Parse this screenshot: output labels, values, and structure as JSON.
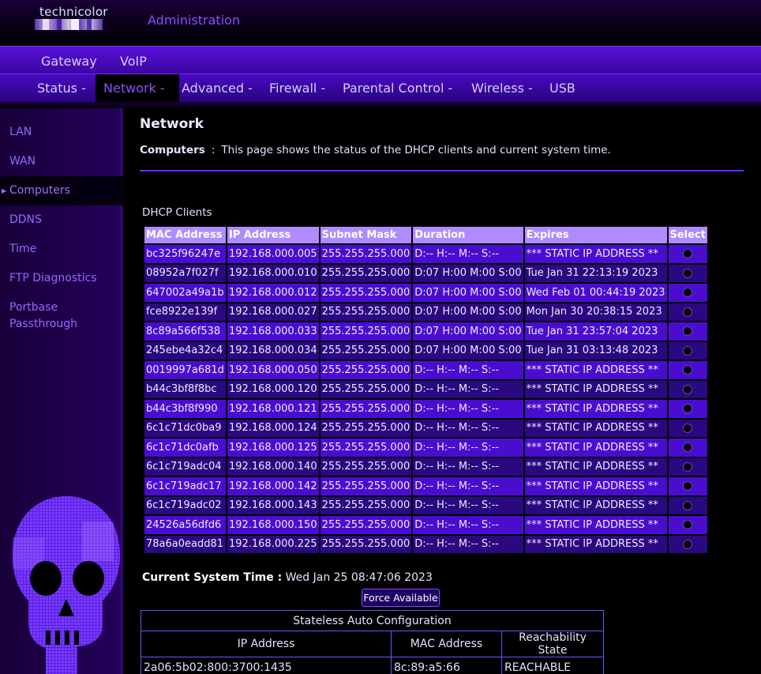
{
  "header": {
    "brand": "technicolor",
    "title": "Administration"
  },
  "nav_primary": [
    "Gateway",
    "VoIP"
  ],
  "nav_secondary": [
    {
      "label": "Status -",
      "active": false
    },
    {
      "label": "Network -",
      "active": true
    },
    {
      "label": "Advanced -",
      "active": false
    },
    {
      "label": "Firewall -",
      "active": false
    },
    {
      "label": "Parental Control -",
      "active": false
    },
    {
      "label": "Wireless -",
      "active": false
    },
    {
      "label": "USB",
      "active": false
    }
  ],
  "sidebar": {
    "items": [
      {
        "label": "LAN"
      },
      {
        "label": "WAN"
      },
      {
        "label": "Computers",
        "active": true
      },
      {
        "label": "DDNS"
      },
      {
        "label": "Time"
      },
      {
        "label": "FTP Diagnostics"
      },
      {
        "label": "Portbase Passthrough"
      }
    ]
  },
  "page": {
    "title": "Network",
    "section": "Computers",
    "separator": ":",
    "description": "This page shows the status of the DHCP clients and current system time."
  },
  "dhcp": {
    "caption": "DHCP Clients",
    "columns": [
      "MAC Address",
      "IP Address",
      "Subnet Mask",
      "Duration",
      "Expires",
      "Select"
    ],
    "rows": [
      [
        "bc325f96247e",
        "192.168.000.005",
        "255.255.255.000",
        "D:-- H:-- M:-- S:--",
        "*** STATIC IP ADDRESS **"
      ],
      [
        "08952a7f027f",
        "192.168.000.010",
        "255.255.255.000",
        "D:07 H:00 M:00 S:00",
        "Tue Jan 31 22:13:19 2023"
      ],
      [
        "647002a49a1b",
        "192.168.000.012",
        "255.255.255.000",
        "D:07 H:00 M:00 S:00",
        "Wed Feb 01 00:44:19 2023"
      ],
      [
        "fce8922e139f",
        "192.168.000.027",
        "255.255.255.000",
        "D:07 H:00 M:00 S:00",
        "Mon Jan 30 20:38:15 2023"
      ],
      [
        "8c89a566f538",
        "192.168.000.033",
        "255.255.255.000",
        "D:07 H:00 M:00 S:00",
        "Tue Jan 31 23:57:04 2023"
      ],
      [
        "245ebe4a32c4",
        "192.168.000.034",
        "255.255.255.000",
        "D:07 H:00 M:00 S:00",
        "Tue Jan 31 03:13:48 2023"
      ],
      [
        "0019997a681d",
        "192.168.000.050",
        "255.255.255.000",
        "D:-- H:-- M:-- S:--",
        "*** STATIC IP ADDRESS **"
      ],
      [
        "b44c3bf8f8bc",
        "192.168.000.120",
        "255.255.255.000",
        "D:-- H:-- M:-- S:--",
        "*** STATIC IP ADDRESS **"
      ],
      [
        "b44c3bf8f990",
        "192.168.000.121",
        "255.255.255.000",
        "D:-- H:-- M:-- S:--",
        "*** STATIC IP ADDRESS **"
      ],
      [
        "6c1c71dc0ba9",
        "192.168.000.124",
        "255.255.255.000",
        "D:-- H:-- M:-- S:--",
        "*** STATIC IP ADDRESS **"
      ],
      [
        "6c1c71dc0afb",
        "192.168.000.125",
        "255.255.255.000",
        "D:-- H:-- M:-- S:--",
        "*** STATIC IP ADDRESS **"
      ],
      [
        "6c1c719adc04",
        "192.168.000.140",
        "255.255.255.000",
        "D:-- H:-- M:-- S:--",
        "*** STATIC IP ADDRESS **"
      ],
      [
        "6c1c719adc17",
        "192.168.000.142",
        "255.255.255.000",
        "D:-- H:-- M:-- S:--",
        "*** STATIC IP ADDRESS **"
      ],
      [
        "6c1c719adc02",
        "192.168.000.143",
        "255.255.255.000",
        "D:-- H:-- M:-- S:--",
        "*** STATIC IP ADDRESS **"
      ],
      [
        "24526a56dfd6",
        "192.168.000.150",
        "255.255.255.000",
        "D:-- H:-- M:-- S:--",
        "*** STATIC IP ADDRESS **"
      ],
      [
        "78a6a0eadd81",
        "192.168.000.225",
        "255.255.255.000",
        "D:-- H:-- M:-- S:--",
        "*** STATIC IP ADDRESS **"
      ]
    ]
  },
  "system_time": {
    "label": "Current System Time :",
    "value": "Wed Jan 25 08:47:06 2023"
  },
  "force_button": "Force Available",
  "slaac": {
    "caption": "Stateless Auto Configuration",
    "columns": [
      "IP Address",
      "MAC Address",
      "Reachability State"
    ],
    "rows": [
      [
        "2a06:5b02:800:3700:1435",
        "8c:89:a5:66",
        "REACHABLE"
      ]
    ]
  },
  "icons": {
    "radio": "radio-button-icon",
    "caret": "caret-right-icon",
    "skull": "pixel-skull-icon"
  },
  "colors": {
    "accent": "#8a4dff",
    "nav": "#4808c0",
    "header_cell": "#b08aff",
    "row_odd": "#4a0dd0",
    "row_even": "#2a0880"
  }
}
